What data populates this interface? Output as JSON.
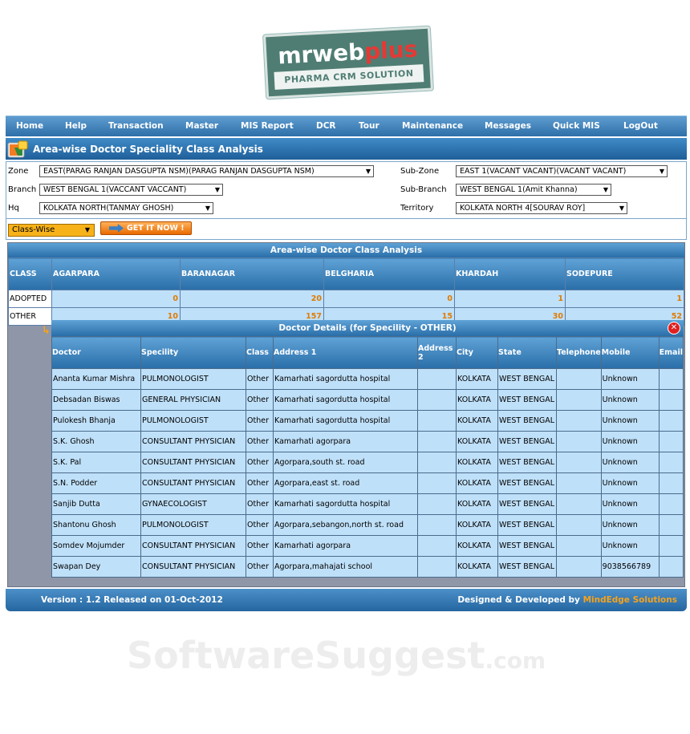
{
  "logo": {
    "brand_main": "mrweb",
    "brand_accent": "plus",
    "tagline": "PHARMA CRM SOLUTION"
  },
  "menu": [
    "Home",
    "Help",
    "Transaction",
    "Master",
    "MIS Report",
    "DCR",
    "Tour",
    "Maintenance",
    "Messages",
    "Quick MIS",
    "LogOut"
  ],
  "page_title": "Area-wise Doctor Speciality Class Analysis",
  "filters": {
    "zone": {
      "label": "Zone",
      "value": "EAST(PARAG RANJAN DASGUPTA NSM)(PARAG RANJAN DASGUPTA NSM)"
    },
    "sub_zone": {
      "label": "Sub-Zone",
      "value": "EAST 1(VACANT VACANT)(VACANT VACANT)"
    },
    "branch": {
      "label": "Branch",
      "value": "WEST BENGAL 1(VACCANT VACCANT)"
    },
    "sub_branch": {
      "label": "Sub-Branch",
      "value": "WEST BENGAL 1(Amit Khanna)"
    },
    "hq": {
      "label": "Hq",
      "value": "KOLKATA NORTH(TANMAY GHOSH)"
    },
    "territory": {
      "label": "Territory",
      "value": "KOLKATA NORTH 4[SOURAV ROY]"
    }
  },
  "view_select": "Class-Wise",
  "get_button": "GET IT NOW !",
  "analysis": {
    "title": "Area-wise Doctor Class Analysis",
    "headers": [
      "CLASS",
      "AGARPARA",
      "BARANAGAR",
      "BELGHARIA",
      "KHARDAH",
      "SODEPURE"
    ],
    "rows": [
      {
        "cls": "ADOPTED",
        "vals": [
          "0",
          "20",
          "0",
          "1",
          "1"
        ]
      },
      {
        "cls": "OTHER",
        "vals": [
          "10",
          "157",
          "15",
          "30",
          "52"
        ]
      }
    ]
  },
  "details": {
    "title": "Doctor Details (for Specility - OTHER)",
    "headers": [
      "Doctor",
      "Specility",
      "Class",
      "Address 1",
      "Address 2",
      "City",
      "State",
      "Telephone",
      "Mobile",
      "Email"
    ],
    "rows": [
      [
        "Ananta Kumar Mishra",
        "PULMONOLOGIST",
        "Other",
        "Kamarhati sagordutta hospital",
        "",
        "KOLKATA",
        "WEST BENGAL",
        "",
        "Unknown",
        ""
      ],
      [
        "Debsadan Biswas",
        "GENERAL PHYSICIAN",
        "Other",
        "Kamarhati sagordutta hospital",
        "",
        "KOLKATA",
        "WEST BENGAL",
        "",
        "Unknown",
        ""
      ],
      [
        "Pulokesh Bhanja",
        "PULMONOLOGIST",
        "Other",
        "Kamarhati sagordutta hospital",
        "",
        "KOLKATA",
        "WEST BENGAL",
        "",
        "Unknown",
        ""
      ],
      [
        "S.K. Ghosh",
        "CONSULTANT PHYSICIAN",
        "Other",
        "Kamarhati agorpara",
        "",
        "KOLKATA",
        "WEST BENGAL",
        "",
        "Unknown",
        ""
      ],
      [
        "S.K. Pal",
        "CONSULTANT PHYSICIAN",
        "Other",
        "Agorpara,south st. road",
        "",
        "KOLKATA",
        "WEST BENGAL",
        "",
        "Unknown",
        ""
      ],
      [
        "S.N. Podder",
        "CONSULTANT PHYSICIAN",
        "Other",
        "Agorpara,east st. road",
        "",
        "KOLKATA",
        "WEST BENGAL",
        "",
        "Unknown",
        ""
      ],
      [
        "Sanjib Dutta",
        "GYNAECOLOGIST",
        "Other",
        "Kamarhati sagordutta hospital",
        "",
        "KOLKATA",
        "WEST BENGAL",
        "",
        "Unknown",
        ""
      ],
      [
        "Shantonu Ghosh",
        "PULMONOLOGIST",
        "Other",
        "Agorpara,sebangon,north st. road",
        "",
        "KOLKATA",
        "WEST BENGAL",
        "",
        "Unknown",
        ""
      ],
      [
        "Somdev Mojumder",
        "CONSULTANT PHYSICIAN",
        "Other",
        "Kamarhati agorpara",
        "",
        "KOLKATA",
        "WEST BENGAL",
        "",
        "Unknown",
        ""
      ],
      [
        "Swapan Dey",
        "CONSULTANT PHYSICIAN",
        "Other",
        "Agorpara,mahajati school",
        "",
        "KOLKATA",
        "WEST BENGAL",
        "",
        "9038566789",
        ""
      ]
    ]
  },
  "footer": {
    "version": "Version : 1.2 Released on 01-Oct-2012",
    "designed_prefix": "Designed & Developed by",
    "designed_brand": "MindEdge Solutions"
  },
  "watermark": {
    "main": "SoftwareSuggest",
    "suffix": ".com"
  },
  "colors": {
    "menu_blue": "#2e6fa8",
    "cell_blue": "#bfe0f9",
    "number_orange": "#e07b00",
    "logo_green": "#4f7d73",
    "logo_red": "#e53935"
  }
}
